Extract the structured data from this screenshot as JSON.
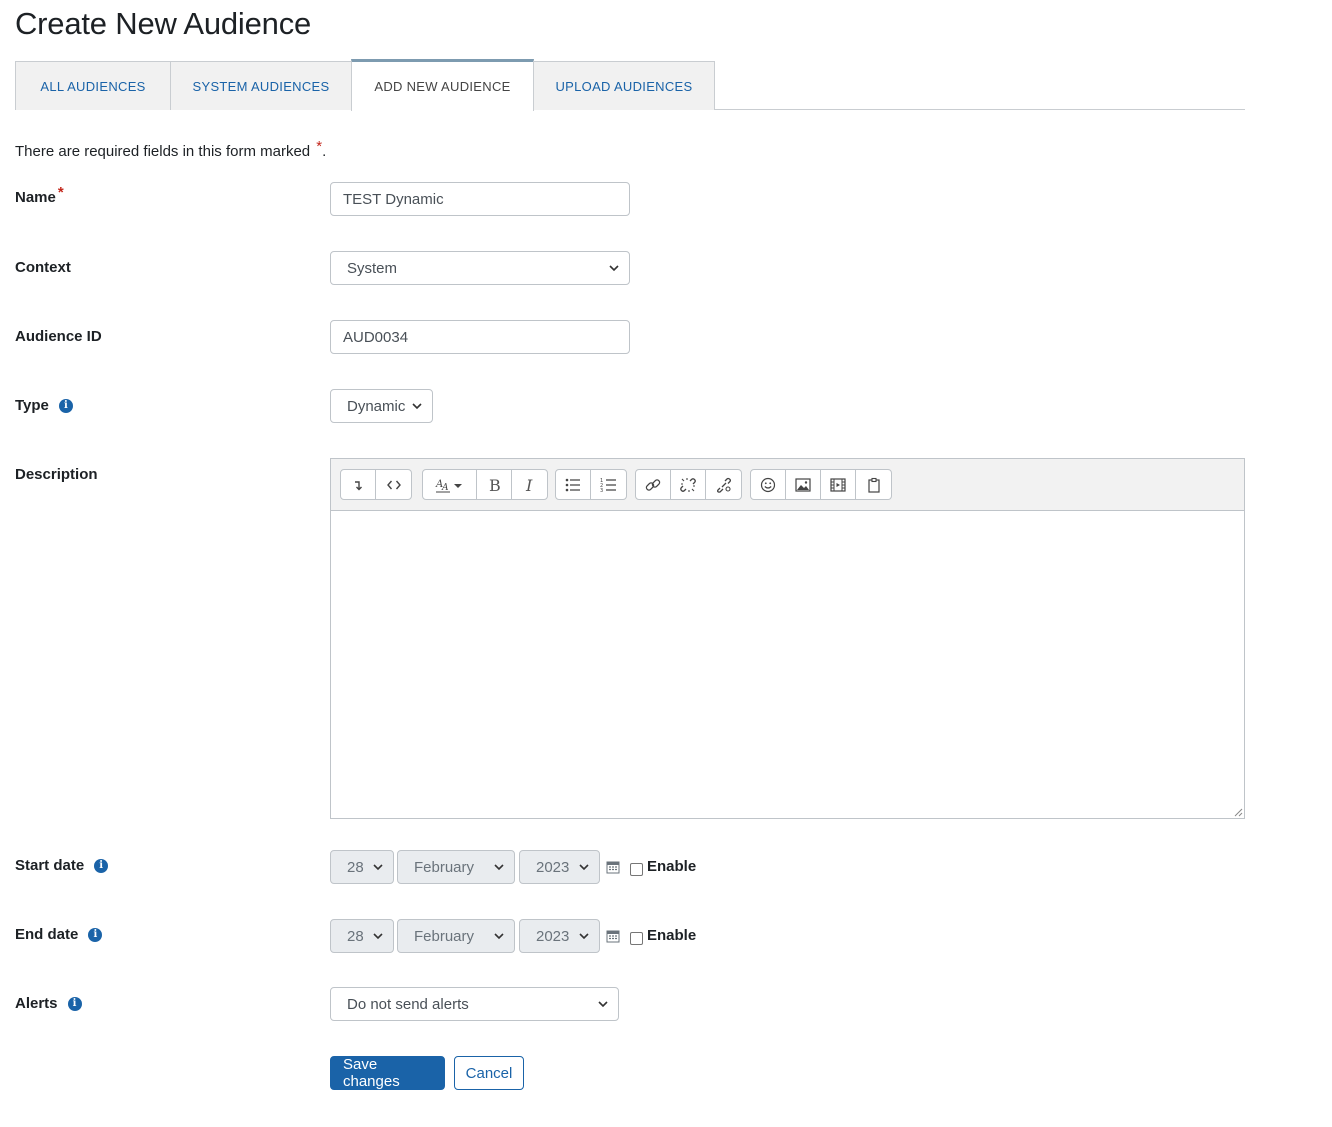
{
  "page": {
    "title": "Create New Audience"
  },
  "tabs": [
    {
      "label": "ALL AUDIENCES"
    },
    {
      "label": "SYSTEM AUDIENCES"
    },
    {
      "label": "ADD NEW AUDIENCE"
    },
    {
      "label": "UPLOAD AUDIENCES"
    }
  ],
  "form": {
    "required_note": "There are required fields in this form marked",
    "required_star": "*",
    "required_note_end": ".",
    "name": {
      "label": "Name",
      "value": "TEST Dynamic"
    },
    "context": {
      "label": "Context",
      "value": "System"
    },
    "audience_id": {
      "label": "Audience ID",
      "value": "AUD0034"
    },
    "type": {
      "label": "Type",
      "value": "Dynamic"
    },
    "description": {
      "label": "Description",
      "value": ""
    },
    "start_date": {
      "label": "Start date",
      "day": "28",
      "month": "February",
      "year": "2023",
      "enable_label": "Enable"
    },
    "end_date": {
      "label": "End date",
      "day": "28",
      "month": "February",
      "year": "2023",
      "enable_label": "Enable"
    },
    "alerts": {
      "label": "Alerts",
      "value": "Do not send alerts"
    }
  },
  "buttons": {
    "save": "Save changes",
    "cancel": "Cancel"
  },
  "colors": {
    "primary": "#1a63a8",
    "required": "#c3261b",
    "text": "#1d2125"
  },
  "icons": {
    "info": "i",
    "toolbar": [
      "collapse-icon",
      "html-icon",
      "font-style-icon",
      "bold-icon",
      "italic-icon",
      "unordered-list-icon",
      "ordered-list-icon",
      "link-icon",
      "unlink-icon",
      "manage-files-icon",
      "emoji-icon",
      "image-icon",
      "media-icon",
      "paste-icon"
    ]
  }
}
